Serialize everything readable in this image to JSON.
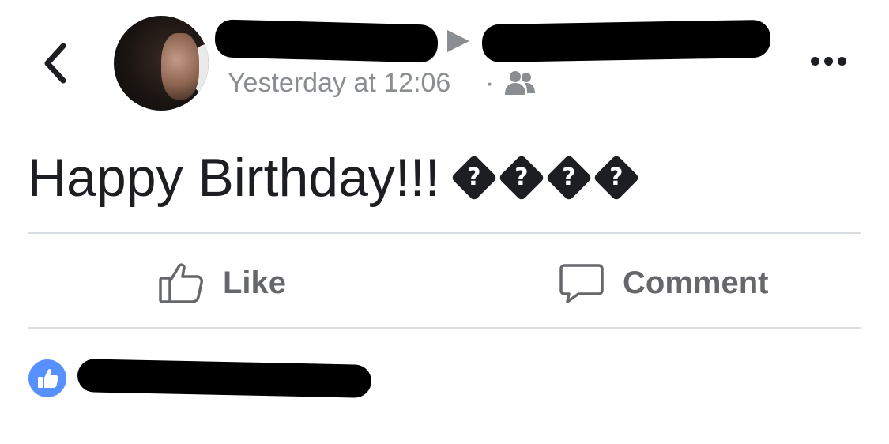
{
  "header": {
    "timestamp": "Yesterday at 12:06",
    "separator": "·",
    "audience_icon": "group-icon",
    "back_icon": "chevron-left-icon",
    "more_icon": "ellipsis-icon"
  },
  "post": {
    "text": "Happy Birthday!!!",
    "emojis": [
      "?",
      "?",
      "?",
      "?"
    ]
  },
  "actions": {
    "like_label": "Like",
    "comment_label": "Comment"
  },
  "reactions": {
    "icon": "thumbs-up-icon"
  },
  "colors": {
    "secondary_text": "#8a8d91",
    "action_text": "#65676b",
    "like_blue": "#5890ff",
    "divider": "#dadde1"
  }
}
